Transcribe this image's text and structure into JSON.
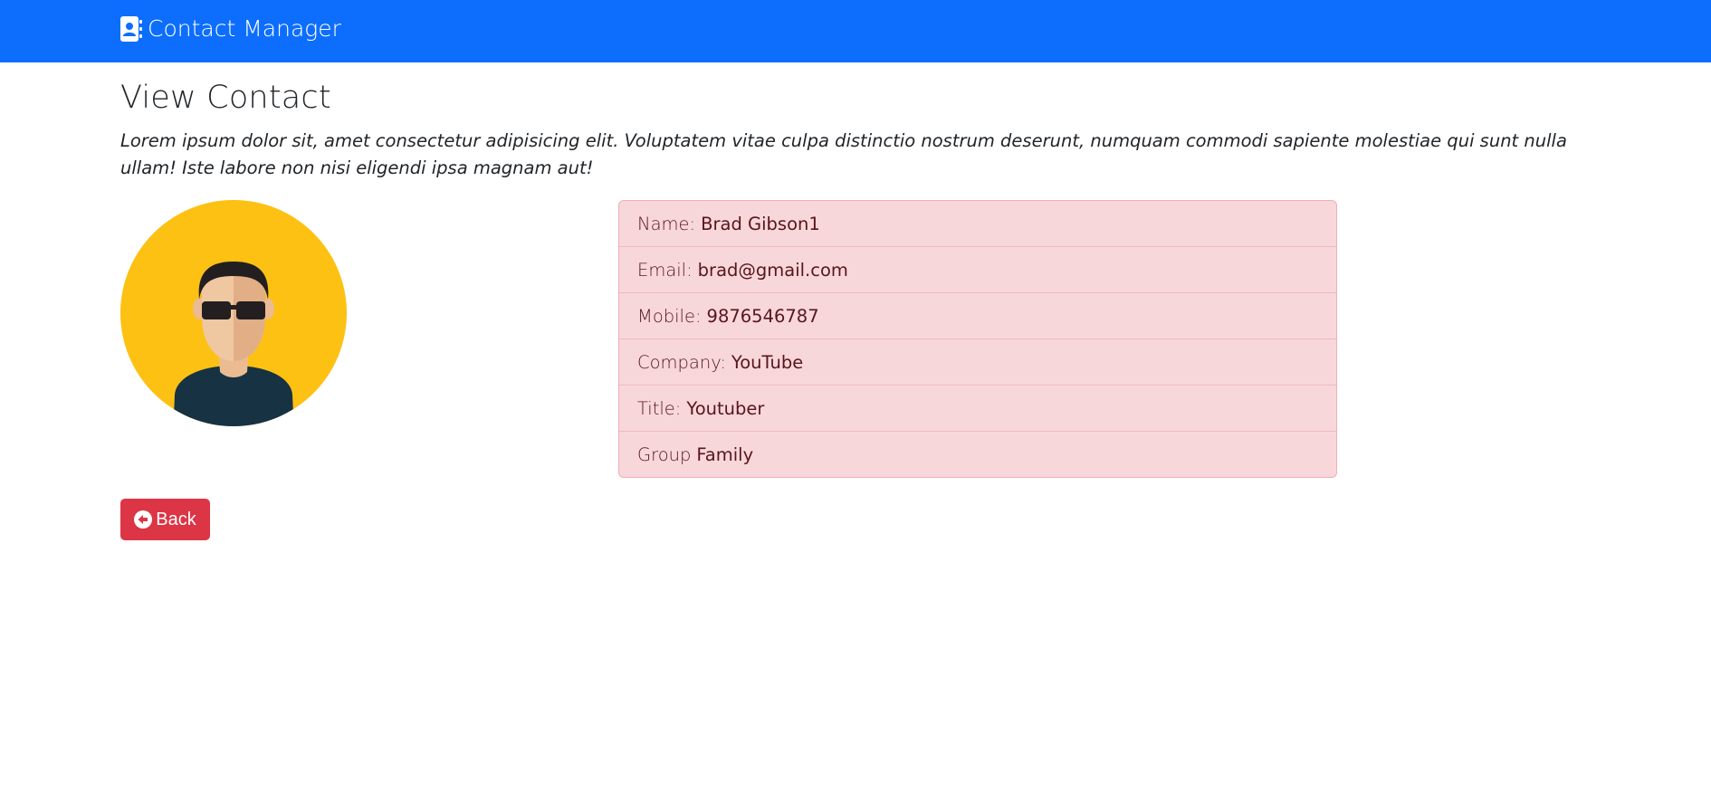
{
  "navbar": {
    "brand_label": "Contact Manager",
    "brand_icon": "address-book-icon",
    "color": "#0d6efd"
  },
  "page": {
    "title": "View Contact",
    "lead": "Lorem ipsum dolor sit, amet consectetur adipisicing elit. Voluptatem vitae culpa distinctio nostrum deserunt, numquam commodi sapiente molestiae qui sunt nulla ullam! Iste labore non nisi eligendi ipsa magnam aut!"
  },
  "avatar": {
    "icon": "user-avatar-sunglasses"
  },
  "contact": {
    "fields": [
      {
        "label": "Name:",
        "value": "Brad Gibson1"
      },
      {
        "label": "Email:",
        "value": "brad@gmail.com"
      },
      {
        "label": "Mobile:",
        "value": "9876546787"
      },
      {
        "label": "Company:",
        "value": "YouTube"
      },
      {
        "label": "Title:",
        "value": "Youtuber"
      },
      {
        "label": "Group",
        "value": "Family"
      }
    ]
  },
  "actions": {
    "back_label": "Back",
    "back_icon": "arrow-left-circle-icon",
    "back_color": "#dc3545"
  }
}
